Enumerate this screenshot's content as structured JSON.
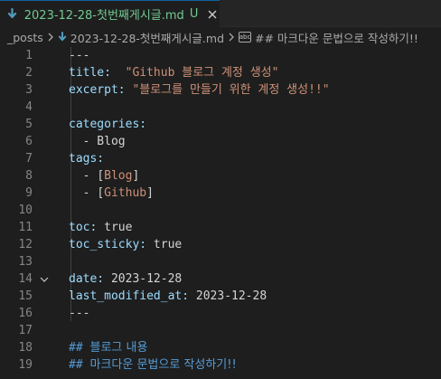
{
  "tab": {
    "label": "2023-12-28-첫번째게시글.md",
    "status": "U"
  },
  "breadcrumb": {
    "folder": "_posts",
    "file": "2023-12-28-첫번째게시글.md",
    "section": "## 마크다운 문법으로 작성하기!!",
    "hash_icon_text": "abc"
  },
  "editor": {
    "lines": [
      {
        "num": "1",
        "parts": [
          {
            "t": "---",
            "c": "c-dash"
          }
        ]
      },
      {
        "num": "2",
        "parts": [
          {
            "t": "title:",
            "c": "c-key"
          },
          {
            "t": "  ",
            "c": "c-txt"
          },
          {
            "t": "\"Github 블로그 계정 생성\"",
            "c": "c-str"
          }
        ]
      },
      {
        "num": "3",
        "parts": [
          {
            "t": "excerpt:",
            "c": "c-key"
          },
          {
            "t": " ",
            "c": "c-txt"
          },
          {
            "t": "\"블로그를 만들기 위한 계정 생성!!\"",
            "c": "c-str"
          }
        ]
      },
      {
        "num": "4",
        "parts": []
      },
      {
        "num": "5",
        "parts": [
          {
            "t": "categories:",
            "c": "c-key"
          }
        ]
      },
      {
        "num": "6",
        "parts": [
          {
            "t": "  - Blog",
            "c": "c-txt"
          }
        ]
      },
      {
        "num": "7",
        "parts": [
          {
            "t": "tags:",
            "c": "c-key"
          }
        ]
      },
      {
        "num": "8",
        "parts": [
          {
            "t": "  - ",
            "c": "c-txt"
          },
          {
            "t": "[",
            "c": "c-txt"
          },
          {
            "t": "Blog",
            "c": "c-str"
          },
          {
            "t": "]",
            "c": "c-txt"
          }
        ]
      },
      {
        "num": "9",
        "parts": [
          {
            "t": "  - ",
            "c": "c-txt"
          },
          {
            "t": "[",
            "c": "c-txt"
          },
          {
            "t": "Github",
            "c": "c-str"
          },
          {
            "t": "]",
            "c": "c-txt"
          }
        ]
      },
      {
        "num": "10",
        "parts": []
      },
      {
        "num": "11",
        "parts": [
          {
            "t": "toc:",
            "c": "c-key"
          },
          {
            "t": " true",
            "c": "c-txt"
          }
        ]
      },
      {
        "num": "12",
        "parts": [
          {
            "t": "toc_sticky:",
            "c": "c-key"
          },
          {
            "t": " true",
            "c": "c-txt"
          }
        ]
      },
      {
        "num": "13",
        "parts": []
      },
      {
        "num": "14",
        "parts": [
          {
            "t": "date:",
            "c": "c-key"
          },
          {
            "t": " 2023-12-28",
            "c": "c-txt"
          }
        ],
        "fold": true
      },
      {
        "num": "15",
        "parts": [
          {
            "t": "last_modified_at:",
            "c": "c-key"
          },
          {
            "t": " 2023-12-28",
            "c": "c-txt"
          }
        ]
      },
      {
        "num": "16",
        "parts": [
          {
            "t": "---",
            "c": "c-dash"
          }
        ]
      },
      {
        "num": "17",
        "parts": []
      },
      {
        "num": "18",
        "parts": [
          {
            "t": "## ",
            "c": "c-head"
          },
          {
            "t": "블로그 내용",
            "c": "c-headtxt"
          }
        ]
      },
      {
        "num": "19",
        "parts": [
          {
            "t": "## ",
            "c": "c-head"
          },
          {
            "t": "마크다운 문법으로 작성하기!!",
            "c": "c-headtxt"
          }
        ]
      }
    ]
  },
  "colors": {
    "background": "#1e1e1e",
    "modified_file": "#73c991",
    "key": "#9cdcfe",
    "string": "#ce9178",
    "heading": "#569cd6",
    "line_number": "#858585"
  }
}
